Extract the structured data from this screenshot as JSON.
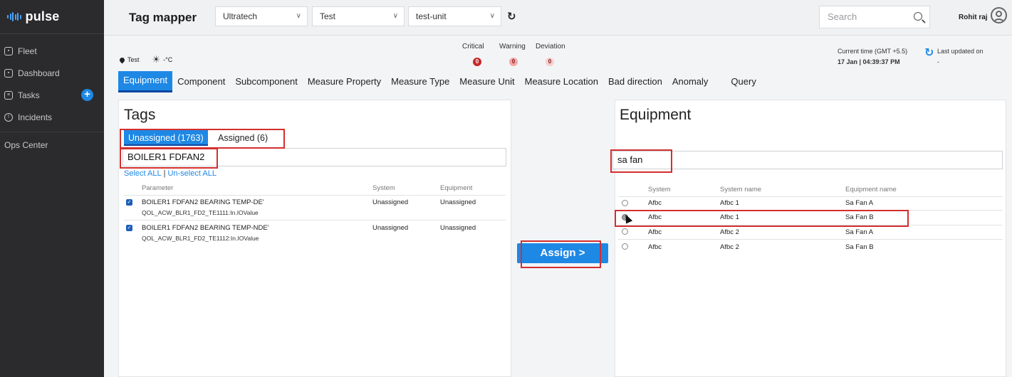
{
  "brand": {
    "name": "pulse"
  },
  "sidebar": {
    "items": [
      {
        "label": "Fleet",
        "icon": "fleet-icon"
      },
      {
        "label": "Dashboard",
        "icon": "dashboard-icon"
      },
      {
        "label": "Tasks",
        "icon": "tasks-icon"
      },
      {
        "label": "Incidents",
        "icon": "incidents-icon"
      }
    ],
    "ops_center": "Ops Center"
  },
  "header": {
    "title": "Tag mapper",
    "selects": [
      {
        "value": "Ultratech"
      },
      {
        "value": "Test"
      },
      {
        "value": "test-unit"
      }
    ],
    "search_placeholder": "Search",
    "user_name": "Rohit raj"
  },
  "info": {
    "location": "Test",
    "temperature": "-°C",
    "status": {
      "critical_label": "Critical",
      "critical_count": "0",
      "warning_label": "Warning",
      "warning_count": "0",
      "deviation_label": "Deviation",
      "deviation_count": "0"
    },
    "current_time_label": "Current time (GMT +5.5)",
    "current_time_value": "17 Jan | 04:39:37 PM",
    "last_updated_label": "Last updated on",
    "last_updated_value": "-"
  },
  "tabs": [
    "Equipment",
    "Component",
    "Subcomponent",
    "Measure Property",
    "Measure Type",
    "Measure Unit",
    "Measure Location",
    "Bad direction",
    "Anomaly",
    "Query"
  ],
  "tags_panel": {
    "title": "Tags",
    "unassigned_tab": "Unassigned (1763)",
    "assigned_tab": "Assigned (6)",
    "filter_value": "BOILER1 FDFAN2",
    "select_all": "Select ALL",
    "separator": "|",
    "unselect_all": "Un-select ALL",
    "columns": [
      "Parameter",
      "System",
      "Equipment"
    ],
    "rows": [
      {
        "param": "BOILER1 FDFAN2 BEARING TEMP-DE'",
        "tag": "QOL_ACW_BLR1_FD2_TE1111:In.IOValue",
        "system": "Unassigned",
        "equipment": "Unassigned",
        "checked": true
      },
      {
        "param": "BOILER1 FDFAN2 BEARING TEMP-NDE'",
        "tag": "QOL_ACW_BLR1_FD2_TE1112:In.IOValue",
        "system": "Unassigned",
        "equipment": "Unassigned",
        "checked": true
      }
    ]
  },
  "assign_button": "Assign >",
  "equipment_panel": {
    "title": "Equipment",
    "filter_value": "sa fan",
    "columns": [
      "System",
      "System name",
      "Equipment name"
    ],
    "rows": [
      {
        "system": "Afbc",
        "system_name": "Afbc 1",
        "equipment_name": "Sa Fan A",
        "selected": false
      },
      {
        "system": "Afbc",
        "system_name": "Afbc 1",
        "equipment_name": "Sa Fan B",
        "selected": true
      },
      {
        "system": "Afbc",
        "system_name": "Afbc 2",
        "equipment_name": "Sa Fan A",
        "selected": false
      },
      {
        "system": "Afbc",
        "system_name": "Afbc 2",
        "equipment_name": "Sa Fan B",
        "selected": false
      }
    ]
  },
  "colors": {
    "accent": "#1e88e5",
    "sidebar_bg": "#2b2b2d",
    "highlight": "#d32f2f"
  }
}
